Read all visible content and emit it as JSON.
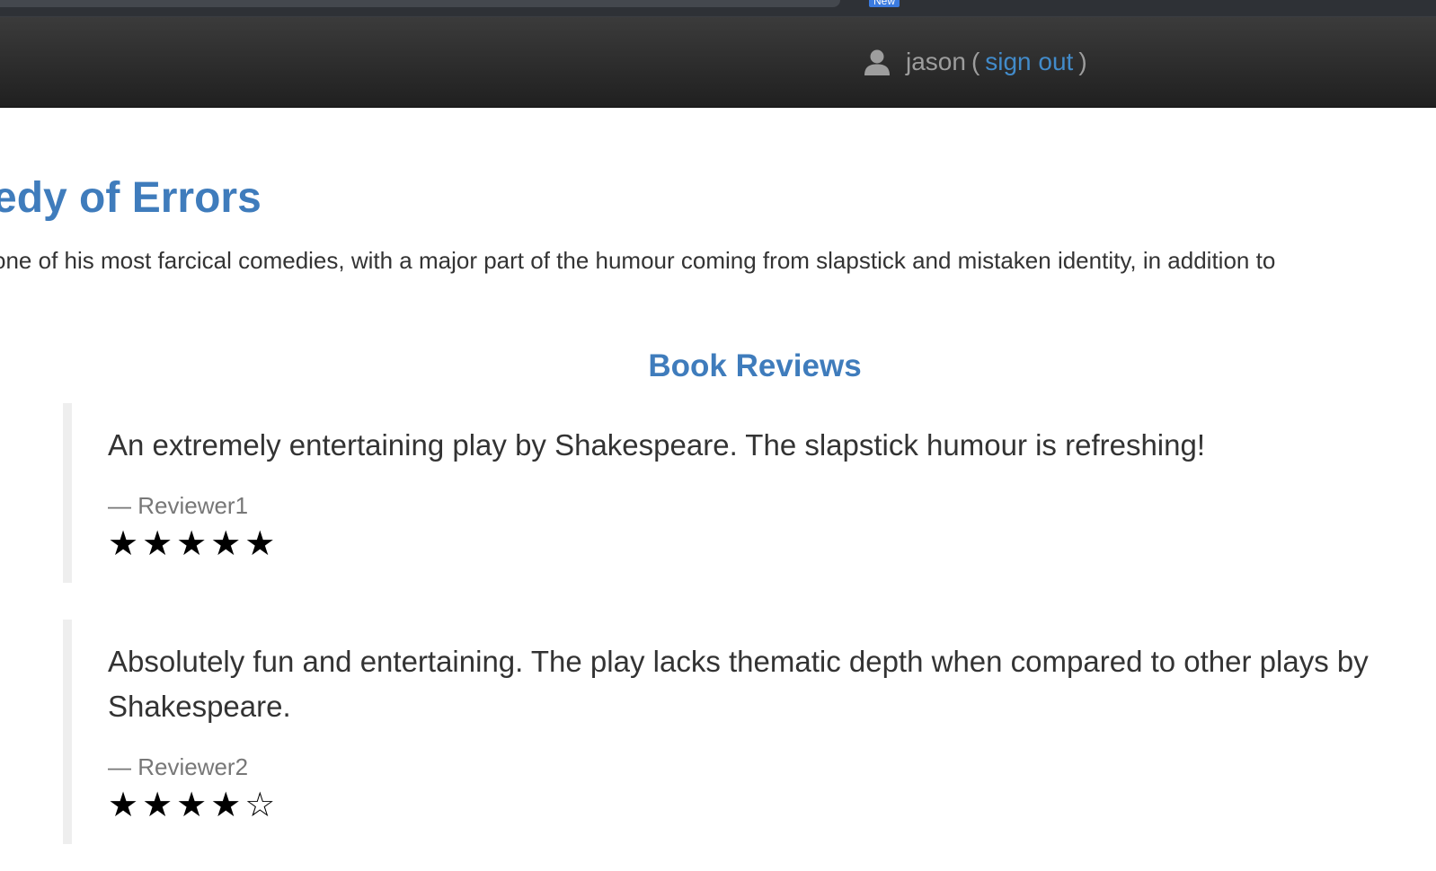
{
  "browser": {
    "new_badge": "New"
  },
  "navbar": {
    "user_icon": "user-icon",
    "username": "jason",
    "open_paren": "(",
    "sign_out_label": "sign out",
    "close_paren": ")"
  },
  "book": {
    "title": "edy of Errors",
    "summary": "one of his most farcical comedies, with a major part of the humour coming from slapstick and mistaken identity, in addition to"
  },
  "reviews_section": {
    "heading": "Book Reviews",
    "reviews": [
      {
        "text": "An extremely entertaining play by Shakespeare. The slapstick humour is refreshing!",
        "reviewer": "— Reviewer1",
        "rating": 5,
        "stars": "★★★★★"
      },
      {
        "text": "Absolutely fun and entertaining. The play lacks thematic depth when compared to other plays by Shakespeare.",
        "reviewer": "— Reviewer2",
        "rating": 4,
        "stars": "★★★★☆"
      }
    ]
  },
  "colors": {
    "accent": "#3f7cbc",
    "link": "#428bca",
    "navbar": "#2a2a2a",
    "text": "#333333",
    "muted": "#777777"
  }
}
